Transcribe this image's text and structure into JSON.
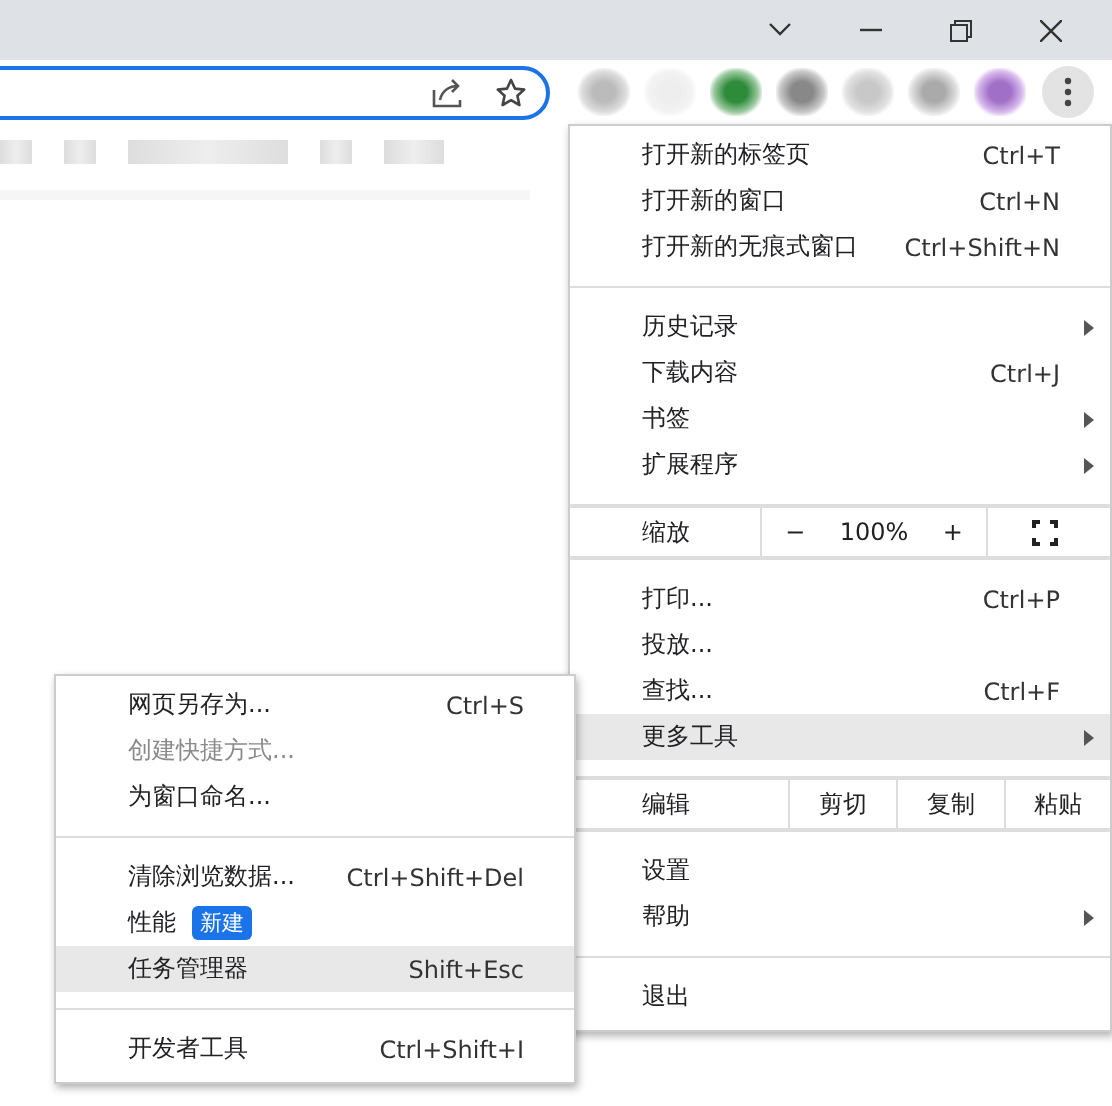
{
  "window_controls": [
    {
      "kind": "tabs"
    },
    {
      "kind": "minimize"
    },
    {
      "kind": "restore"
    },
    {
      "kind": "close"
    }
  ],
  "main_menu": [
    {
      "kind": "item",
      "label": "打开新的标签页",
      "shortcut": "Ctrl+T",
      "has_submenu": false,
      "selected": false
    },
    {
      "kind": "item",
      "label": "打开新的窗口",
      "shortcut": "Ctrl+N",
      "has_submenu": false,
      "selected": false
    },
    {
      "kind": "item",
      "label": "打开新的无痕式窗口",
      "shortcut": "Ctrl+Shift+N",
      "has_submenu": false,
      "selected": false
    },
    {
      "kind": "separator"
    },
    {
      "kind": "item",
      "label": "历史记录",
      "has_submenu": true,
      "selected": false
    },
    {
      "kind": "item",
      "label": "下载内容",
      "shortcut": "Ctrl+J",
      "has_submenu": false,
      "selected": false
    },
    {
      "kind": "item",
      "label": "书签",
      "has_submenu": true,
      "selected": false
    },
    {
      "kind": "item",
      "label": "扩展程序",
      "has_submenu": true,
      "selected": false
    },
    {
      "kind": "separator"
    },
    {
      "kind": "zoom",
      "label": "缩放",
      "minus": "−",
      "value": "100%",
      "plus": "+"
    },
    {
      "kind": "separator"
    },
    {
      "kind": "item",
      "label": "打印...",
      "shortcut": "Ctrl+P",
      "has_submenu": false,
      "selected": false
    },
    {
      "kind": "item",
      "label": "投放...",
      "has_submenu": false,
      "selected": false
    },
    {
      "kind": "item",
      "label": "查找...",
      "shortcut": "Ctrl+F",
      "has_submenu": false,
      "selected": false
    },
    {
      "kind": "item",
      "label": "更多工具",
      "has_submenu": true,
      "selected": true
    },
    {
      "kind": "separator"
    },
    {
      "kind": "edit",
      "label": "编辑",
      "buttons": [
        "剪切",
        "复制",
        "粘贴"
      ]
    },
    {
      "kind": "separator"
    },
    {
      "kind": "item",
      "label": "设置",
      "has_submenu": false,
      "selected": false
    },
    {
      "kind": "item",
      "label": "帮助",
      "has_submenu": true,
      "selected": false
    },
    {
      "kind": "separator"
    },
    {
      "kind": "item",
      "label": "退出",
      "has_submenu": false,
      "selected": false
    }
  ],
  "more_tools_submenu": [
    {
      "kind": "item",
      "label": "网页另存为...",
      "shortcut": "Ctrl+S",
      "disabled": false,
      "selected": false
    },
    {
      "kind": "item",
      "label": "创建快捷方式...",
      "disabled": true,
      "selected": false
    },
    {
      "kind": "item",
      "label": "为窗口命名...",
      "disabled": false,
      "selected": false
    },
    {
      "kind": "separator"
    },
    {
      "kind": "item",
      "label": "清除浏览数据...",
      "shortcut": "Ctrl+Shift+Del",
      "disabled": false,
      "selected": false
    },
    {
      "kind": "item",
      "label": "性能",
      "badge": "新建",
      "disabled": false,
      "selected": false
    },
    {
      "kind": "item",
      "label": "任务管理器",
      "shortcut": "Shift+Esc",
      "disabled": false,
      "selected": true
    },
    {
      "kind": "separator"
    },
    {
      "kind": "item",
      "label": "开发者工具",
      "shortcut": "Ctrl+Shift+I",
      "disabled": false,
      "selected": false
    }
  ]
}
